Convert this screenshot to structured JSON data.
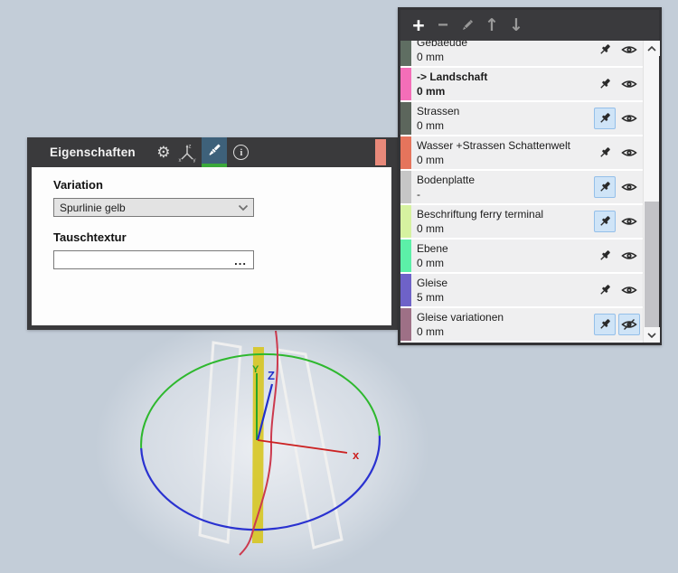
{
  "properties_panel": {
    "title": "Eigenschaften",
    "gear_glyph": "⚙",
    "info_glyph": "i",
    "indicator_color": "#e8897a",
    "variation": {
      "label": "Variation",
      "value": "Spurlinie gelb"
    },
    "tauschtextur": {
      "label": "Tauschtextur",
      "value": "",
      "browse_label": "..."
    }
  },
  "layers_panel": {
    "toolbar": {
      "add_label": "+",
      "remove_label": "−",
      "move_up_label": "↑",
      "move_down_label": "↓"
    },
    "items": [
      {
        "name": "Gebaeude",
        "height": "0 mm",
        "color": "#5f6e62",
        "pinned": false,
        "visible": true,
        "bold": false,
        "clipped": true
      },
      {
        "name": "-> Landschaft",
        "height": "0 mm",
        "color": "#f46eb8",
        "pinned": false,
        "visible": true,
        "bold": true
      },
      {
        "name": "Strassen",
        "height": "0 mm",
        "color": "#5c665c",
        "pinned": true,
        "visible": true,
        "bold": false
      },
      {
        "name": "Wasser +Strassen Schattenwelt",
        "height": "0 mm",
        "color": "#e5745c",
        "pinned": false,
        "visible": true,
        "bold": false
      },
      {
        "name": "Bodenplatte",
        "height": "-",
        "color": "#c6c6c6",
        "pinned": true,
        "visible": true,
        "bold": false
      },
      {
        "name": "Beschriftung ferry terminal",
        "height": "0 mm",
        "color": "#d6f2a0",
        "pinned": true,
        "visible": true,
        "bold": false
      },
      {
        "name": "Ebene",
        "height": "0 mm",
        "color": "#5cf0a8",
        "pinned": false,
        "visible": true,
        "bold": false
      },
      {
        "name": "Gleise",
        "height": "5 mm",
        "color": "#6e62c8",
        "pinned": false,
        "visible": true,
        "bold": false
      },
      {
        "name": "Gleise variationen",
        "height": "0 mm",
        "color": "#9e7086",
        "pinned": true,
        "visible": false,
        "bold": false
      }
    ]
  },
  "viewport": {
    "background": "#c3cdd8",
    "axes": {
      "x": {
        "label": "x",
        "color": "#cc2222"
      },
      "y": {
        "label": "Y",
        "color": "#28a428"
      },
      "z": {
        "label": "Z",
        "color": "#2230cc"
      }
    },
    "ring_colors": {
      "top": "#2eb82e",
      "bottom": "#2a32d0",
      "vertical": "#cc3a4e"
    },
    "selected_object_color": "#d6c51c"
  }
}
